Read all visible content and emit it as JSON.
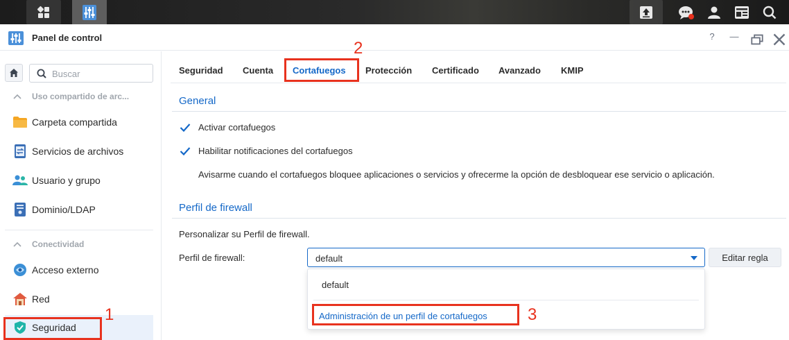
{
  "window": {
    "title": "Panel de control"
  },
  "taskbar": {
    "icons": [
      "apps-grid-icon",
      "control-panel-icon",
      "upload-icon",
      "chat-icon",
      "user-icon",
      "widgets-icon",
      "search-icon"
    ]
  },
  "sidebar": {
    "search_placeholder": "Buscar",
    "groups": [
      {
        "label": "Uso compartido de arc..."
      },
      {
        "label": "Conectividad"
      }
    ],
    "items": [
      {
        "label": "Carpeta compartida",
        "icon": "folder-icon"
      },
      {
        "label": "Servicios de archivos",
        "icon": "file-services-icon"
      },
      {
        "label": "Usuario y grupo",
        "icon": "users-icon"
      },
      {
        "label": "Dominio/LDAP",
        "icon": "domain-icon"
      },
      {
        "label": "Acceso externo",
        "icon": "external-access-icon"
      },
      {
        "label": "Red",
        "icon": "network-home-icon"
      },
      {
        "label": "Seguridad",
        "icon": "shield-icon",
        "selected": true
      }
    ]
  },
  "tabs": [
    {
      "label": "Seguridad"
    },
    {
      "label": "Cuenta"
    },
    {
      "label": "Cortafuegos",
      "active": true
    },
    {
      "label": "Protección"
    },
    {
      "label": "Certificado"
    },
    {
      "label": "Avanzado"
    },
    {
      "label": "KMIP"
    }
  ],
  "general": {
    "title": "General",
    "enable_firewall": {
      "label": "Activar cortafuegos",
      "checked": true
    },
    "enable_notifications": {
      "label": "Habilitar notificaciones del cortafuegos",
      "checked": true
    },
    "notify_description": "Avisarme cuando el cortafuegos bloquee aplicaciones o servicios y ofrecerme la opción de desbloquear ese servicio o aplicación."
  },
  "profile": {
    "title": "Perfil de firewall",
    "description": "Personalizar su Perfil de firewall.",
    "field_label": "Perfil de firewall:",
    "selected_value": "default",
    "edit_button": "Editar regla",
    "dropdown_options": [
      "default",
      "Administración de un perfil de cortafuegos"
    ]
  },
  "annotations": [
    "1",
    "2",
    "3"
  ],
  "colors": {
    "accent": "#1468c8",
    "annotation": "#e8321e",
    "selected_bg": "#eaf1fb"
  }
}
